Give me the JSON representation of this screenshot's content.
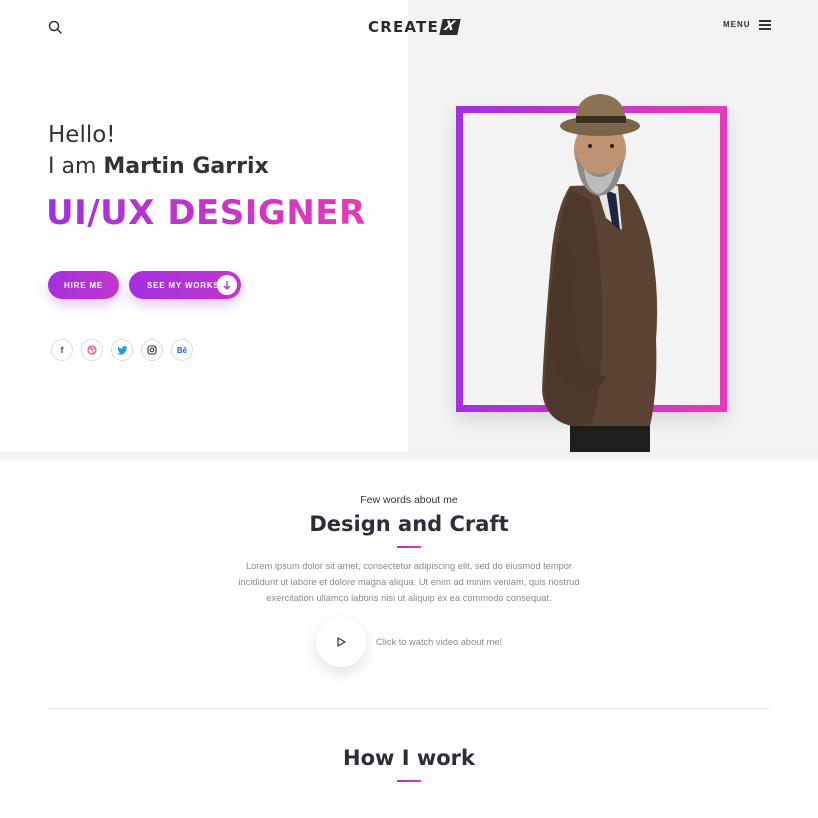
{
  "header": {
    "logo_text": "CREATE",
    "logo_mark": "X",
    "menu_label": "MENU",
    "search_icon": "search-icon",
    "menu_icon": "hamburger-icon"
  },
  "hero": {
    "greeting": "Hello!",
    "intro": "I am",
    "name": "Martin Garrix",
    "role": "UI/UX DESIGNER",
    "hire_label": "HIRE ME",
    "works_label": "SEE MY WORKS",
    "works_icon": "arrow-down-icon",
    "socials": [
      {
        "icon": "facebook-icon",
        "glyph": "f",
        "color": "#3b5998"
      },
      {
        "icon": "dribbble-icon",
        "glyph": "◎",
        "color": "#ea4c89"
      },
      {
        "icon": "twitter-icon",
        "glyph": "🐦",
        "color": "#1da1f2"
      },
      {
        "icon": "instagram-icon",
        "glyph": "◻",
        "color": "#333333"
      },
      {
        "icon": "behance-icon",
        "glyph": "Bē",
        "color": "#1769ff"
      }
    ],
    "accent_start": "#a52ee2",
    "accent_end": "#e83ab6"
  },
  "about": {
    "kicker": "Few words about me",
    "title": "Design and Craft",
    "paragraph_lines": [
      "Lorem ipsum dolor sit amet, consectetur adipiscing elit, sed do eiusmod tempor",
      "incididunt ut labore et dolore magna aliqua. Ut enim ad minim veniam, quis nostrud",
      "exercitation ullamco laboris nisi ut aliquip ex ea commodo consequat."
    ],
    "video_text": "Click to watch video about me!"
  },
  "how": {
    "title": "How I work"
  }
}
